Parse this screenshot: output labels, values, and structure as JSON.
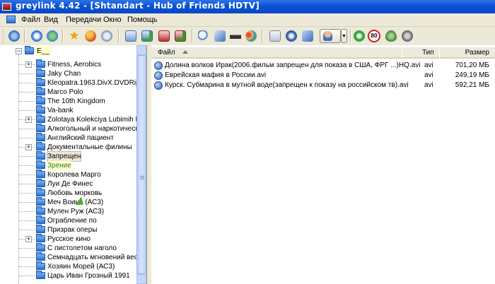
{
  "window": {
    "title": "greylink 4.42 - [Shtandart - Hub of Friends HDTV]"
  },
  "menu": [
    "Файл",
    "Вид",
    "Передачи",
    "Окно",
    "Помощь"
  ],
  "toolbar": {
    "buttons": [
      "connect-icon",
      "refresh-icon",
      "network-icon",
      "favorites-icon",
      "users-icon",
      "search-users-icon",
      "queue-icon",
      "queue-ok-icon",
      "download-icon",
      "download-ok-icon",
      "search-icon",
      "spy-icon",
      "hat-icon",
      "palette-icon",
      "notepad-icon",
      "settings-icon",
      "book-icon",
      "user-icon",
      "power-icon",
      "limit-icon",
      "shield-icon",
      "speaker-icon"
    ],
    "limit_badge": "80"
  },
  "tree": {
    "root": "E__",
    "items": [
      {
        "label": "Fitness, Aerobics",
        "expandable": true
      },
      {
        "label": "Jaky Chan",
        "expandable": false
      },
      {
        "label": "Kleopatra.1963.DivX.DVDRip",
        "expandable": false
      },
      {
        "label": "Marco Polo",
        "expandable": false
      },
      {
        "label": "The 10th Kingdom",
        "expandable": false
      },
      {
        "label": "Va-bank",
        "expandable": false
      },
      {
        "label": "Zolotaya Kolekciya Lubimih Multf",
        "expandable": true
      },
      {
        "label": "Алкогольный и наркотически",
        "expandable": false
      },
      {
        "label": "Английский пациент",
        "expandable": false
      },
      {
        "label": "Документальные филины",
        "expandable": true
      },
      {
        "label": "Запрещен",
        "expandable": false
      },
      {
        "label": "Зрение",
        "expandable": false
      },
      {
        "label": "Королева Марго",
        "expandable": false
      },
      {
        "label": "Луи Де Финес",
        "expandable": false
      },
      {
        "label": "Любовь морковь",
        "expandable": false
      },
      {
        "label": "Меч Воина (АС3)",
        "expandable": false
      },
      {
        "label": "Мулен Руж (АС3)",
        "expandable": false
      },
      {
        "label": "Ограбление по",
        "expandable": false
      },
      {
        "label": "Призрак оперы",
        "expandable": false
      },
      {
        "label": "Русское кино",
        "expandable": true
      },
      {
        "label": "С пистолетом наголо",
        "expandable": false
      },
      {
        "label": "Семнадцать мгновений весны",
        "expandable": false
      },
      {
        "label": "Хозяин Морей (АС3)",
        "expandable": false
      },
      {
        "label": "Царь Иван Грозный 1991",
        "expandable": false
      }
    ]
  },
  "list": {
    "columns": {
      "name": "Файл",
      "type": "Тип",
      "size": "Размер"
    },
    "rows": [
      {
        "name": "Долина волков Ирак(2006.фильм запрещен для показа в США, ФРГ ...)HQ.avi",
        "type": "avi",
        "size": "701,20 МБ"
      },
      {
        "name": "Еврейская мафия в России.avi",
        "type": "avi",
        "size": "249,19 МБ"
      },
      {
        "name": "Курск. Субмарина в мутной воде(запрещен к показу на российском тв).avi",
        "type": "avi",
        "size": "592,21 МБ"
      }
    ]
  }
}
